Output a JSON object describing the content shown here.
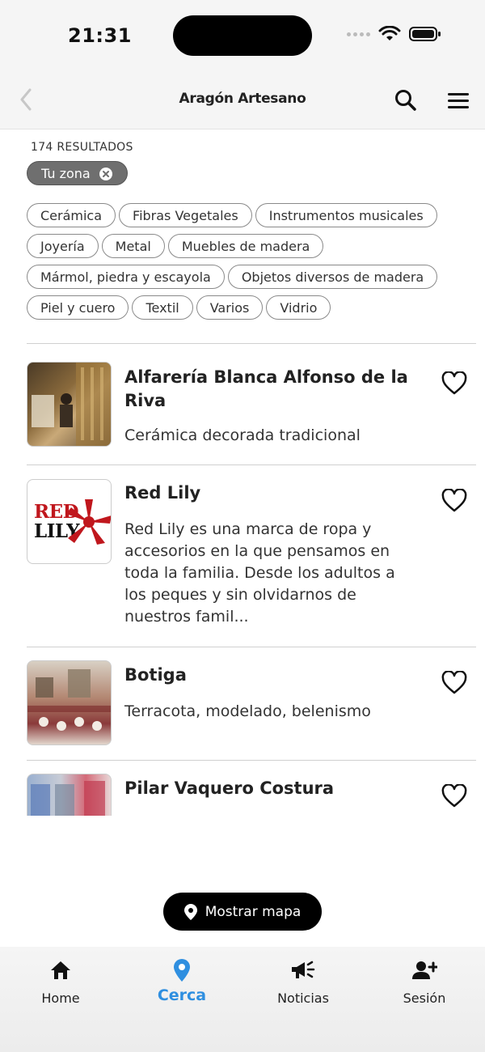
{
  "status": {
    "time": "21:31"
  },
  "header": {
    "title": "Aragón Artesano"
  },
  "results": {
    "count_label": "174 RESULTADOS"
  },
  "active_filter": {
    "label": "Tu zona"
  },
  "categories": [
    "Cerámica",
    "Fibras Vegetales",
    "Instrumentos musicales",
    "Joyería",
    "Metal",
    "Muebles de madera",
    "Mármol, piedra y escayola",
    "Objetos diversos de madera",
    "Piel y cuero",
    "Textil",
    "Varios",
    "Vidrio"
  ],
  "items": [
    {
      "title": "Alfarería Blanca Alfonso de la Riva",
      "description": "Cerámica decorada tradicional"
    },
    {
      "title": "Red Lily",
      "description": "Red Lily es una marca de ropa y accesorios en la que pensamos en toda la familia. Desde los adultos a los peques y sin olvidarnos de nuestros famil...",
      "logo_text_1": "RED",
      "logo_text_2": "LILY"
    },
    {
      "title": "Botiga",
      "description": "Terracota, modelado, belenismo"
    },
    {
      "title": "Pilar Vaquero Costura",
      "description": ""
    }
  ],
  "map_button": {
    "label": "Mostrar mapa"
  },
  "tabs": [
    {
      "label": "Home",
      "icon": "home-icon"
    },
    {
      "label": "Cerca",
      "icon": "location-pin-icon"
    },
    {
      "label": "Noticias",
      "icon": "megaphone-icon"
    },
    {
      "label": "Sesión",
      "icon": "add-user-icon"
    }
  ],
  "colors": {
    "accent": "#2f8fe0",
    "chip_active": "#6f6f6f",
    "logo_red": "#c0171d"
  }
}
